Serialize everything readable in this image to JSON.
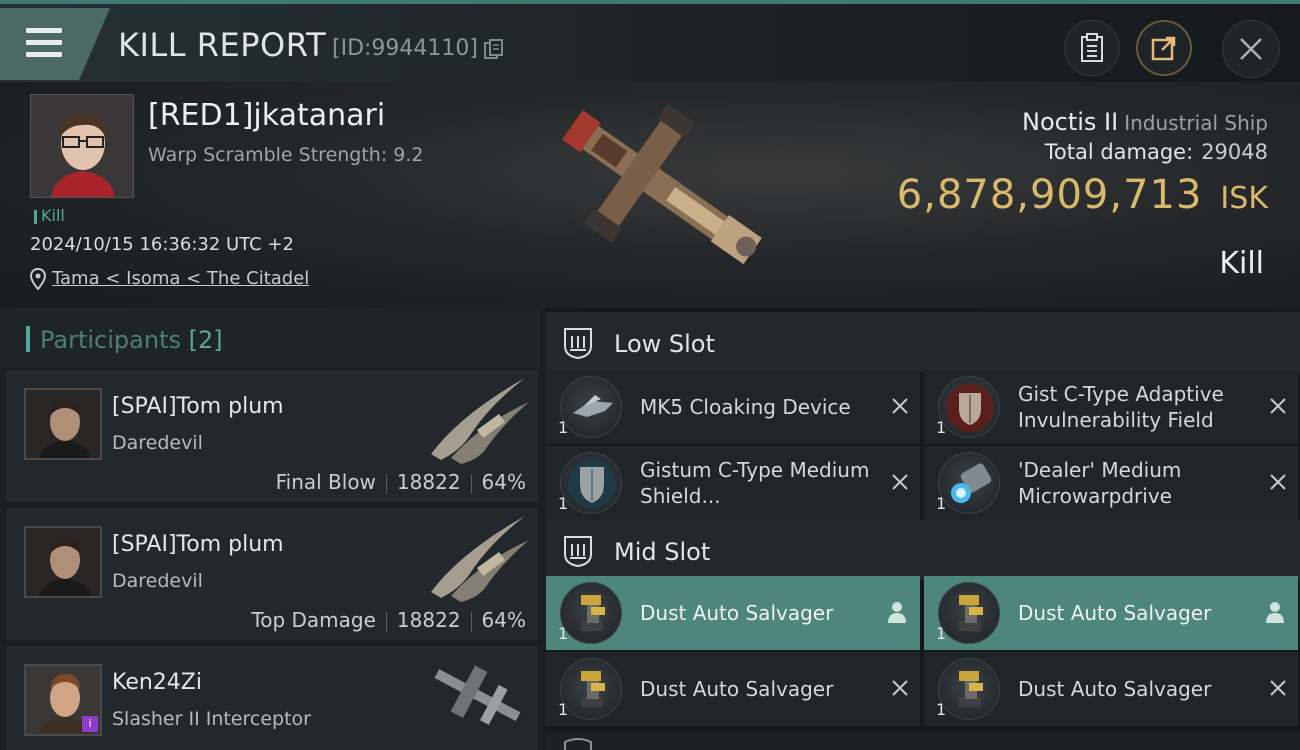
{
  "header": {
    "title": "KILL REPORT",
    "report_id": "[ID:9944110]"
  },
  "victim": {
    "name": "[RED1]jkatanari",
    "warp_scramble": "Warp Scramble Strength: 9.2",
    "tag": "Kill",
    "datetime": "2024/10/15 16:36:32 UTC +2",
    "location": "Tama < Isoma < The Citadel",
    "ship_name": "Noctis II",
    "ship_class": "Industrial Ship",
    "total_damage_label": "Total damage:",
    "total_damage": "29048",
    "isk_value": "6,878,909,713",
    "isk_unit": "ISK",
    "outcome": "Kill"
  },
  "participants": {
    "title": "Participants",
    "count": "[2]",
    "items": [
      {
        "name": "[SPAI]Tom plum",
        "ship": "Daredevil",
        "role": "Final Blow",
        "damage": "18822",
        "percent": "64%"
      },
      {
        "name": "[SPAI]Tom plum",
        "ship": "Daredevil",
        "role": "Top Damage",
        "damage": "18822",
        "percent": "64%"
      },
      {
        "name": "Ken24Zi",
        "ship": "Slasher II Interceptor",
        "badge": "i"
      }
    ]
  },
  "fitting": {
    "low_slot_label": "Low Slot",
    "mid_slot_label": "Mid Slot",
    "low_slot": [
      {
        "name": "MK5 Cloaking Device",
        "qty": "1"
      },
      {
        "name": "Gist C-Type Adaptive Invulnerability Field",
        "qty": "1"
      },
      {
        "name": "Gistum C-Type Medium Shield...",
        "qty": "1"
      },
      {
        "name": "'Dealer' Medium Microwarpdrive",
        "qty": "1"
      }
    ],
    "mid_slot": [
      {
        "name": "Dust Auto Salvager",
        "qty": "1"
      },
      {
        "name": "Dust Auto Salvager",
        "qty": "1"
      },
      {
        "name": "Dust Auto Salvager",
        "qty": "1"
      },
      {
        "name": "Dust Auto Salvager",
        "qty": "1"
      }
    ]
  },
  "colors": {
    "accent_teal": "#4fa99b",
    "isk_gold": "#d9b96c",
    "active_row": "#4e857c"
  },
  "icons": [
    "menu-icon",
    "copy-icon",
    "clipboard-icon",
    "share-icon",
    "close-icon",
    "location-pin-icon",
    "slot-shield-icon",
    "remove-x-icon",
    "person-icon"
  ]
}
